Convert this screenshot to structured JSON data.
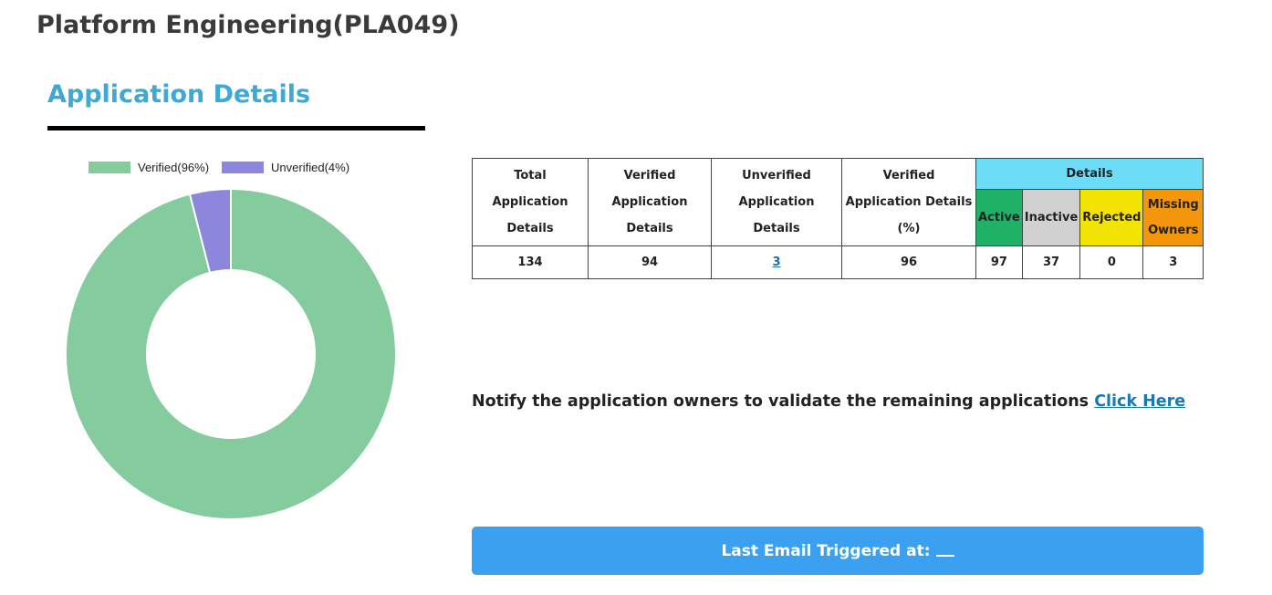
{
  "page": {
    "title": "Platform Engineering(PLA049)"
  },
  "section": {
    "title": "Application Details"
  },
  "chart_data": {
    "type": "pie",
    "donut": true,
    "legend_position": "top",
    "slices": [
      {
        "label": "Verified(96%)",
        "value": 96,
        "color": "#84cb9e"
      },
      {
        "label": "Unverified(4%)",
        "value": 4,
        "color": "#8c87dd"
      }
    ]
  },
  "table": {
    "headers": {
      "total": "Total Application Details",
      "verified": "Verified Application Details",
      "unverified": "Unverified Application Details",
      "percent": "Verified Application Details (%)",
      "details": "Details",
      "active": "Active",
      "inactive": "Inactive",
      "rejected": "Rejected",
      "missing": "Missing Owners"
    },
    "row": {
      "total": "134",
      "verified": "94",
      "unverified": "3",
      "percent": "96",
      "active": "97",
      "inactive": "37",
      "rejected": "0",
      "missing": "3"
    }
  },
  "notify": {
    "text": "Notify the application owners to validate the remaining applications",
    "link": "Click Here"
  },
  "email": {
    "label": "Last Email Triggered at:"
  },
  "colors": {
    "accent": "#3fa9d5",
    "button": "#3ba0ef",
    "active": "#1fb166",
    "inactive": "#d1d1d1",
    "rejected": "#f2e400",
    "missing": "#f3960b",
    "details": "#6dddf7"
  }
}
